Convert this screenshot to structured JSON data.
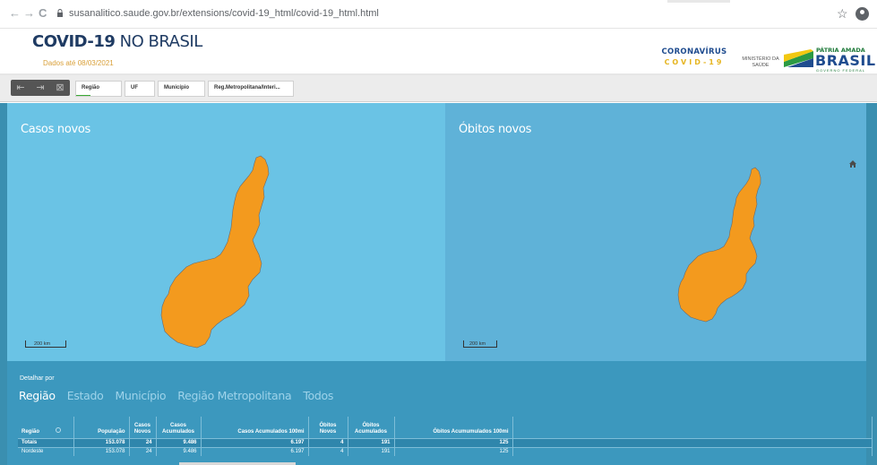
{
  "browser": {
    "url": "susanalitico.saude.gov.br/extensions/covid-19_html/covid-19_html.html",
    "back_glyph": "←",
    "forward_glyph": "→",
    "reload_glyph": "C",
    "star_glyph": "☆"
  },
  "header": {
    "title_bold": "COVID-19",
    "title_light": " NO BRASIL",
    "subtitle": "Dados até 08/03/2021",
    "logo_coronavirus": "CORONAVÍRUS",
    "logo_covid": "COVID-19",
    "logo_ministerio_1": "MINISTÉRIO DA",
    "logo_ministerio_2": "SAÚDE",
    "logo_patria": "PÁTRIA AMADA",
    "logo_brasil": "BRASIL",
    "logo_governo": "GOVERNO FEDERAL"
  },
  "toolbar": {
    "filters": [
      "Região",
      "UF",
      "Município",
      "Reg.Metropolitana/Interi..."
    ]
  },
  "maps": {
    "left_title": "Casos novos",
    "right_title": "Óbitos novos",
    "scale_label": "200 km"
  },
  "detail": {
    "label": "Detalhar por",
    "tabs": [
      "Região",
      "Estado",
      "Município",
      "Região Metropolitana",
      "Todos"
    ],
    "active_tab": "Região"
  },
  "table": {
    "columns": [
      "Região",
      "População",
      "Casos Novos",
      "Casos Acumulados",
      "Casos Acumulados 100mi",
      "Óbitos Novos",
      "Óbitos Acumulados",
      "Óbitos Acumumulados 100mi"
    ],
    "rows": [
      [
        "Totais",
        "153.078",
        "24",
        "9.486",
        "6.197",
        "4",
        "191",
        "125"
      ],
      [
        "Nordeste",
        "153.078",
        "24",
        "9.486",
        "6.197",
        "4",
        "191",
        "125"
      ]
    ]
  },
  "colors": {
    "map_left_bg": "#6ac3e5",
    "map_right_bg": "#5fb2d8",
    "region_fill": "#f39a1e",
    "detail_bg": "#3c98be",
    "title_color": "#1f3b63",
    "subtitle_color": "#d9a03a"
  }
}
